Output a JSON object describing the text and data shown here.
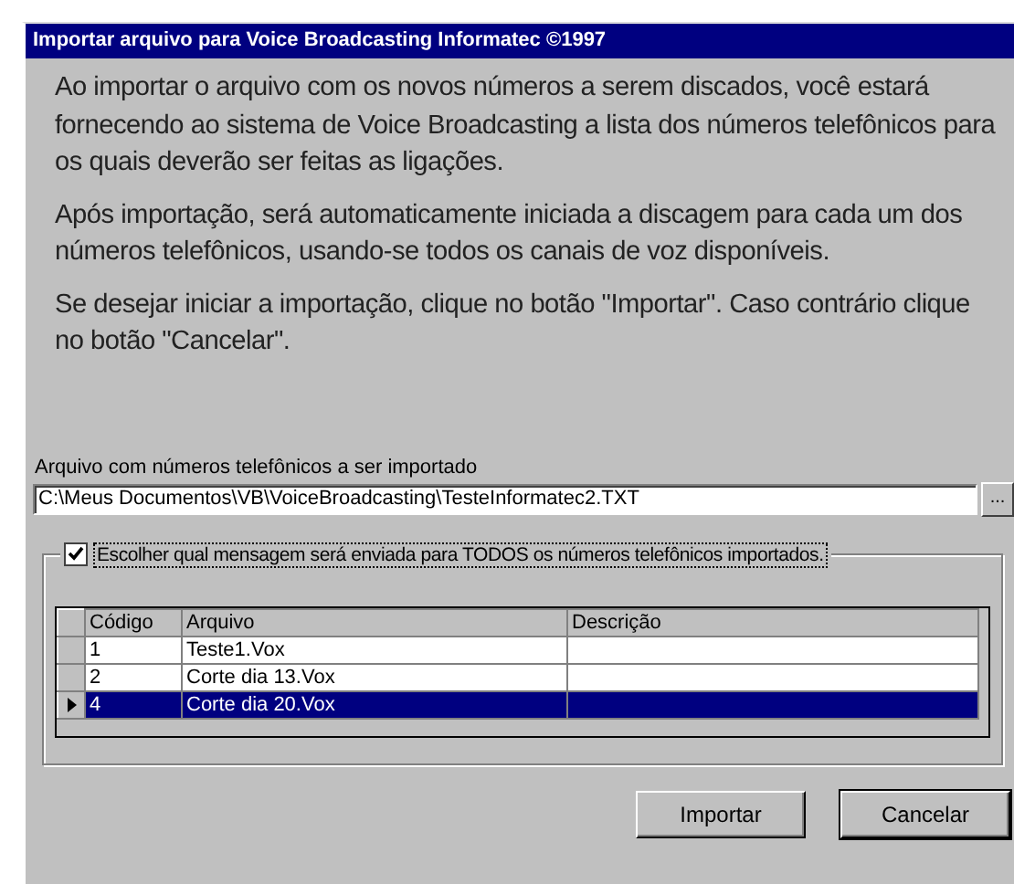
{
  "window": {
    "title": "Importar arquivo para Voice Broadcasting Informatec ©1997"
  },
  "paragraphs": [
    "Ao importar o arquivo com os novos números a serem discados, você estará fornecendo ao sistema de Voice Broadcasting a lista dos números telefônicos para os quais deverão ser feitas as ligações.",
    "Após  importação, será automaticamente iniciada a discagem para cada um dos números telefônicos, usando-se todos os canais de voz disponíveis.",
    "Se desejar iniciar a importação, clique no botão \"Importar\". Caso contrário clique no botão \"Cancelar\"."
  ],
  "file_field": {
    "label": "Arquivo com números telefônicos a  ser importado",
    "value": "C:\\Meus Documentos\\VB\\VoiceBroadcasting\\TesteInformatec2.TXT",
    "browse_button": "..."
  },
  "message_group": {
    "checkbox": {
      "label": "Escolher qual mensagem será enviada para TODOS os números telefônicos importados.",
      "checked": true
    },
    "table": {
      "columns": [
        "Código",
        "Arquivo",
        "Descrição"
      ],
      "rows": [
        {
          "cells": [
            "1",
            "Teste1.Vox"
          ],
          "selected": false
        },
        {
          "cells": [
            "2",
            "Corte dia 13.Vox"
          ],
          "selected": false
        },
        {
          "cells": [
            "4",
            "Corte dia 20.Vox"
          ],
          "selected": true
        }
      ]
    }
  },
  "buttons": [
    "Importar",
    "Cancelar"
  ]
}
